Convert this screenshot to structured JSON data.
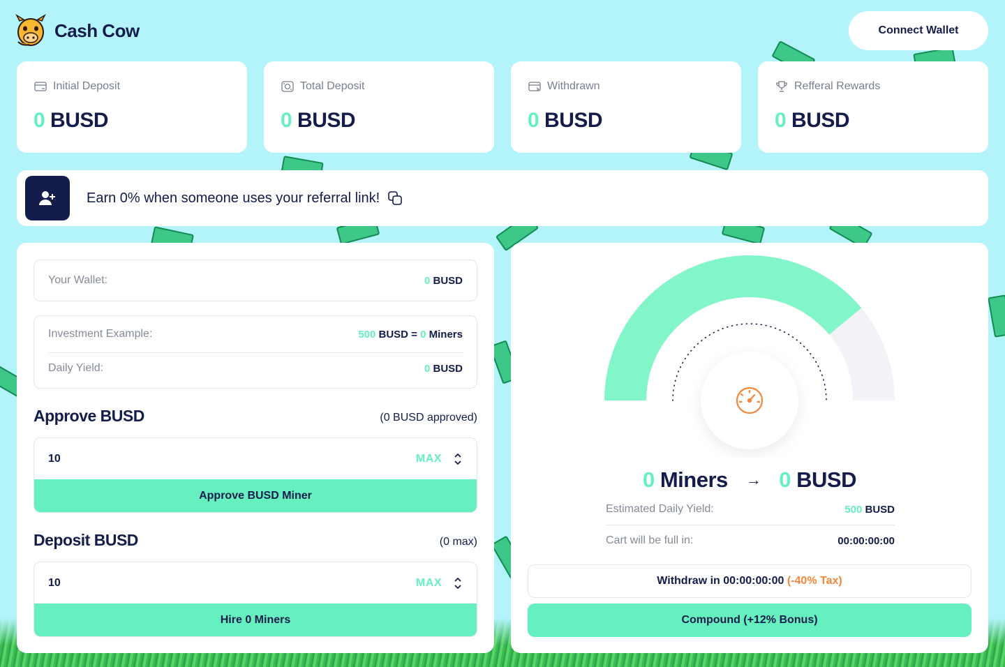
{
  "brand": {
    "name": "Cash Cow"
  },
  "header": {
    "connect_label": "Connect Wallet"
  },
  "stats": [
    {
      "label": "Initial Deposit",
      "value": "0",
      "unit": "BUSD",
      "icon": "wallet-card-icon"
    },
    {
      "label": "Total Deposit",
      "value": "0",
      "unit": "BUSD",
      "icon": "cash-icon"
    },
    {
      "label": "Withdrawn",
      "value": "0",
      "unit": "BUSD",
      "icon": "card-withdraw-icon"
    },
    {
      "label": "Refferal Rewards",
      "value": "0",
      "unit": "BUSD",
      "icon": "trophy-icon"
    }
  ],
  "referral": {
    "text": "Earn 0% when someone uses your referral link!"
  },
  "wallet": {
    "label": "Your Wallet:",
    "value": "0",
    "unit": "BUSD"
  },
  "investment": {
    "label": "Investment Example:",
    "amount": "500",
    "amount_unit": "BUSD =",
    "miners": "0",
    "miners_unit": "Miners",
    "yield_label": "Daily Yield:",
    "yield_value": "0",
    "yield_unit": "BUSD"
  },
  "approve": {
    "title": "Approve BUSD",
    "note": "(0 BUSD approved)",
    "input_value": "10",
    "max_label": "MAX",
    "button_label": "Approve BUSD Miner"
  },
  "deposit": {
    "title": "Deposit BUSD",
    "note": "(0 max)",
    "input_value": "10",
    "max_label": "MAX",
    "button_label": "Hire 0 Miners"
  },
  "gauge": {
    "fill_fraction": 0.78,
    "fill_color": "#82f5c9",
    "track_color": "#f1f3f7",
    "icon": "speedometer-icon"
  },
  "summary": {
    "miners_value": "0",
    "miners_unit": "Miners",
    "busd_value": "0",
    "busd_unit": "BUSD",
    "est_label": "Estimated Daily Yield:",
    "est_value": "500",
    "est_unit": "BUSD",
    "cart_label": "Cart will be full in:",
    "cart_value": "00:00:00:00"
  },
  "withdraw": {
    "label": "Withdraw in 00:00:00:00",
    "tax": "(-40% Tax)"
  },
  "compound": {
    "label": "Compound (+12% Bonus)"
  },
  "colors": {
    "accent": "#66f0c0",
    "navy": "#131c4a",
    "background": "#b3f4fb",
    "tax": "#f4873a"
  }
}
